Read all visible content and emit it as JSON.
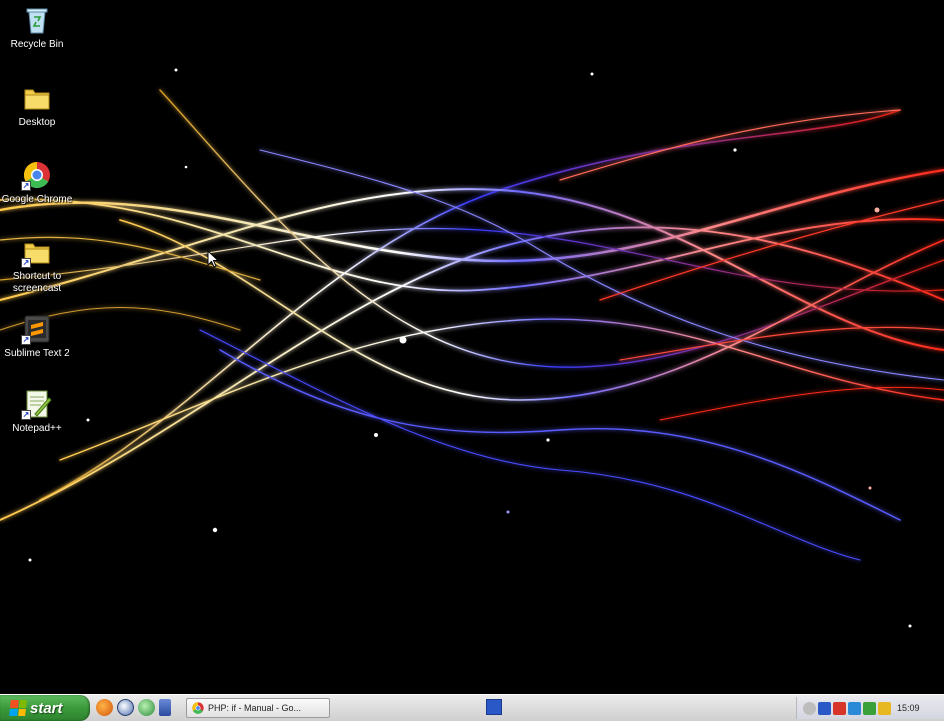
{
  "desktop": {
    "icons": [
      {
        "label": "Recycle Bin",
        "icon": "recycle-bin-icon"
      },
      {
        "label": "Desktop",
        "icon": "folder-icon"
      },
      {
        "label": "Google Chrome",
        "icon": "chrome-icon"
      },
      {
        "label": "Shortcut to screencast",
        "icon": "folder-shortcut-icon"
      },
      {
        "label": "Sublime Text 2",
        "icon": "sublime-text-icon"
      },
      {
        "label": "Notepad++",
        "icon": "notepad-plus-plus-icon"
      }
    ]
  },
  "taskbar": {
    "start_label": "start",
    "quicklaunch": [
      "firefox-icon",
      "media-icon",
      "network-icon",
      "show-desktop-icon"
    ],
    "task_button": {
      "label": "PHP: if - Manual - Go...",
      "icon": "chrome-icon"
    },
    "tray_icons": [
      "volume-icon",
      "network-icon",
      "antivirus-icon",
      "messenger-icon",
      "security-icon",
      "update-icon"
    ],
    "clock": "15:09"
  },
  "colors": {
    "wallpaper": "#000000",
    "start_green": "#3b9a3b",
    "taskbar": "#dcdcdc"
  }
}
